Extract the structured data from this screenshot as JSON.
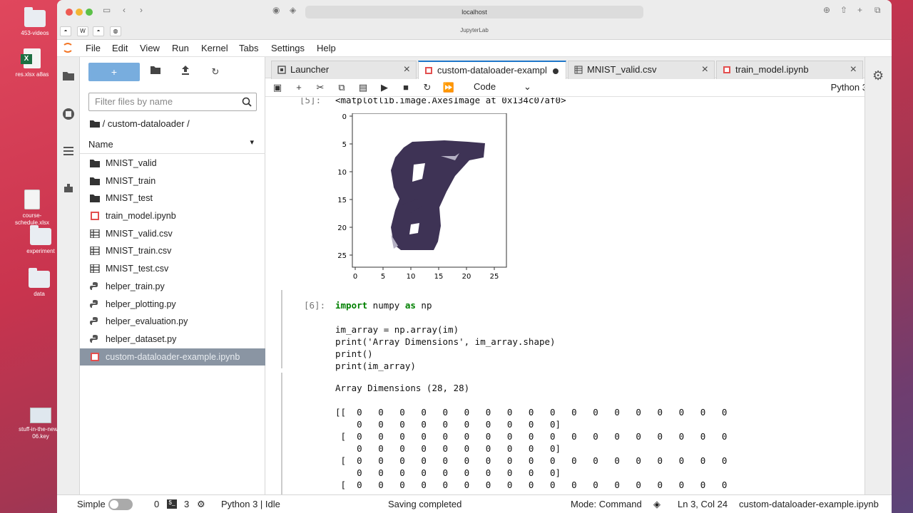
{
  "desktop": {
    "items": [
      {
        "label": "453-videos",
        "type": "folder"
      },
      {
        "label": "res.xlsx a8as",
        "type": "excel"
      },
      {
        "label": "course-schedule.xlsx",
        "type": "file"
      },
      {
        "label": "experiment",
        "type": "folder"
      },
      {
        "label": "data",
        "type": "folder"
      },
      {
        "label": "stuff-in-the-news-06.key",
        "type": "keynote"
      }
    ]
  },
  "browser": {
    "url": "localhost",
    "tab_title": "JupyterLab",
    "colors": {
      "close": "#ee5a52",
      "minimize": "#f2b633",
      "zoom": "#5bc047"
    }
  },
  "menubar": {
    "items": [
      "File",
      "Edit",
      "View",
      "Run",
      "Kernel",
      "Tabs",
      "Settings",
      "Help"
    ]
  },
  "filebrowser": {
    "new_label": "+",
    "filter_placeholder": "Filter files by name",
    "breadcrumb": "/ custom-dataloader /",
    "column_header": "Name",
    "files": [
      {
        "name": "MNIST_valid",
        "icon": "folder-icon"
      },
      {
        "name": "MNIST_train",
        "icon": "folder-icon"
      },
      {
        "name": "MNIST_test",
        "icon": "folder-icon"
      },
      {
        "name": "train_model.ipynb",
        "icon": "notebook-icon"
      },
      {
        "name": "MNIST_valid.csv",
        "icon": "csv-icon"
      },
      {
        "name": "MNIST_train.csv",
        "icon": "csv-icon"
      },
      {
        "name": "MNIST_test.csv",
        "icon": "csv-icon"
      },
      {
        "name": "helper_train.py",
        "icon": "python-icon"
      },
      {
        "name": "helper_plotting.py",
        "icon": "python-icon"
      },
      {
        "name": "helper_evaluation.py",
        "icon": "python-icon"
      },
      {
        "name": "helper_dataset.py",
        "icon": "python-icon"
      },
      {
        "name": "custom-dataloader-example.ipynb",
        "icon": "notebook-icon",
        "selected": true
      }
    ]
  },
  "tabs": [
    {
      "label": "Launcher",
      "active": false
    },
    {
      "label": "custom-dataloader-exampl",
      "active": true
    },
    {
      "label": "MNIST_valid.csv",
      "active": false
    },
    {
      "label": "train_model.ipynb",
      "active": false
    }
  ],
  "toolbar": {
    "cell_type": "Code",
    "kernel": "Python 3"
  },
  "notebook": {
    "out5_prompt": "[5]:",
    "out5_text": "<matplotlib.image.AxesImage at 0x134c07af0>",
    "plot": {
      "yticks": [
        "0",
        "5",
        "10",
        "15",
        "20",
        "25"
      ],
      "xticks": [
        "0",
        "5",
        "10",
        "15",
        "20",
        "25"
      ]
    },
    "in6_prompt": "[6]:",
    "code": [
      "import numpy as np",
      "",
      "im_array = np.array(im)",
      "print('Array Dimensions', im_array.shape)",
      "print()",
      "print(im_array)"
    ],
    "output_dims": "Array Dimensions (28, 28)",
    "output_rows": [
      "[[  0   0   0   0   0   0   0   0   0   0   0   0   0   0   0   0   0   0",
      "    0   0   0   0   0   0   0   0   0   0]",
      " [  0   0   0   0   0   0   0   0   0   0   0   0   0   0   0   0   0   0",
      "    0   0   0   0   0   0   0   0   0   0]",
      " [  0   0   0   0   0   0   0   0   0   0   0   0   0   0   0   0   0   0",
      "    0   0   0   0   0   0   0   0   0   0]",
      " [  0   0   0   0   0   0   0   0   0   0   0   0   0   0   0   0   0   0"
    ]
  },
  "statusbar": {
    "mode_label": "Simple",
    "terminals": "0",
    "kernels": "3",
    "kernel_status": "Python 3 | Idle",
    "saving": "Saving completed",
    "mode": "Mode: Command",
    "cursor": "Ln 3, Col 24",
    "filename": "custom-dataloader-example.ipynb"
  }
}
